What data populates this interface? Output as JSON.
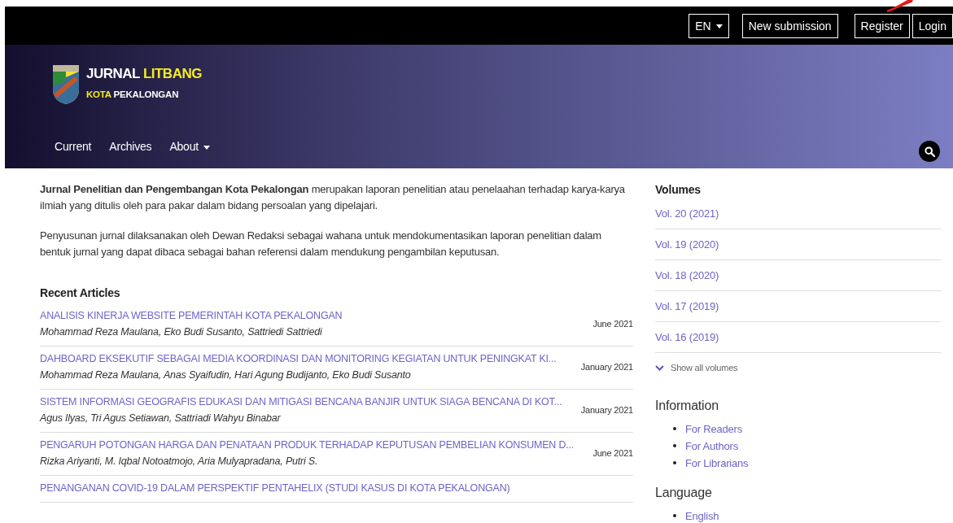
{
  "top_bar": {
    "language": "EN",
    "buttons": [
      "New submission",
      "Register",
      "Login"
    ]
  },
  "logo": {
    "line1": [
      {
        "text": "JURNAL",
        "highlight": false
      },
      {
        "text": "LITBANG",
        "highlight": true
      }
    ],
    "line2": [
      {
        "text": "KOTA",
        "highlight": true
      },
      {
        "text": "PEKALONGAN",
        "highlight": false
      }
    ]
  },
  "nav": [
    {
      "label": "Current",
      "dropdown": false
    },
    {
      "label": "Archives",
      "dropdown": false
    },
    {
      "label": "About",
      "dropdown": true
    }
  ],
  "intro": [
    "**Jurnal Penelitian dan Pengembangan Kota Pekalongan** merupakan laporan penelitian atau penelaahan terhadap karya-karya ilmiah yang ditulis oleh para pakar dalam bidang persoalan yang dipelajari.",
    "Penyusunan jurnal dilaksanakan oleh Dewan Redaksi sebagai wahana untuk mendokumentasikan laporan penelitian dalam bentuk jurnal yang dapat dibaca sebagai bahan referensi dalam mendukung pengambilan keputusan."
  ],
  "recent_articles": {
    "heading": "Recent Articles",
    "items": [
      {
        "title": "ANALISIS KINERJA WEBSITE PEMERINTAH KOTA PEKALONGAN",
        "authors": "Mohammad Reza Maulana, Eko Budi Susanto, Sattriedi Sattriedi",
        "date": "June 2021"
      },
      {
        "title": "DAHBOARD EKSEKUTIF SEBAGAI MEDIA KOORDINASI DAN MONITORING KEGIATAN UNTUK PENINGKAT KI...",
        "authors": "Mohammad Reza Maulana, Anas Syaifudin, Hari Agung Budijanto, Eko Budi Susanto",
        "date": "January 2021"
      },
      {
        "title": "SISTEM INFORMASI GEOGRAFIS EDUKASI DAN MITIGASI BENCANA BANJIR UNTUK SIAGA BENCANA DI KOT...",
        "authors": "Agus Ilyas, Tri Agus Setiawan, Sattriadi Wahyu Binabar",
        "date": "January 2021"
      },
      {
        "title": "PENGARUH POTONGAN HARGA DAN PENATAAN PRODUK TERHADAP KEPUTUSAN PEMBELIAN KONSUMEN D...",
        "authors": "Rizka Ariyanti, M. Iqbal Notoatmojo, Aria Mulyapradana, Putri S.",
        "date": "June 2021"
      },
      {
        "title": "PENANGANAN COVID-19 DALAM PERSPEKTIF PENTAHELIX (STUDI KASUS DI KOTA PEKALONGAN)"
      }
    ]
  },
  "sidebar": {
    "volumes": {
      "heading": "Volumes",
      "items": [
        "Vol. 20 (2021)",
        "Vol. 19 (2020)",
        "Vol. 18 (2020)",
        "Vol. 17 (2019)",
        "Vol. 16 (2019)"
      ],
      "show_all": "Show all volumes"
    },
    "information": {
      "heading": "Information",
      "items": [
        "For Readers",
        "For Authors",
        "For Librarians"
      ]
    },
    "language": {
      "heading": "Language",
      "items": [
        "English"
      ]
    }
  }
}
